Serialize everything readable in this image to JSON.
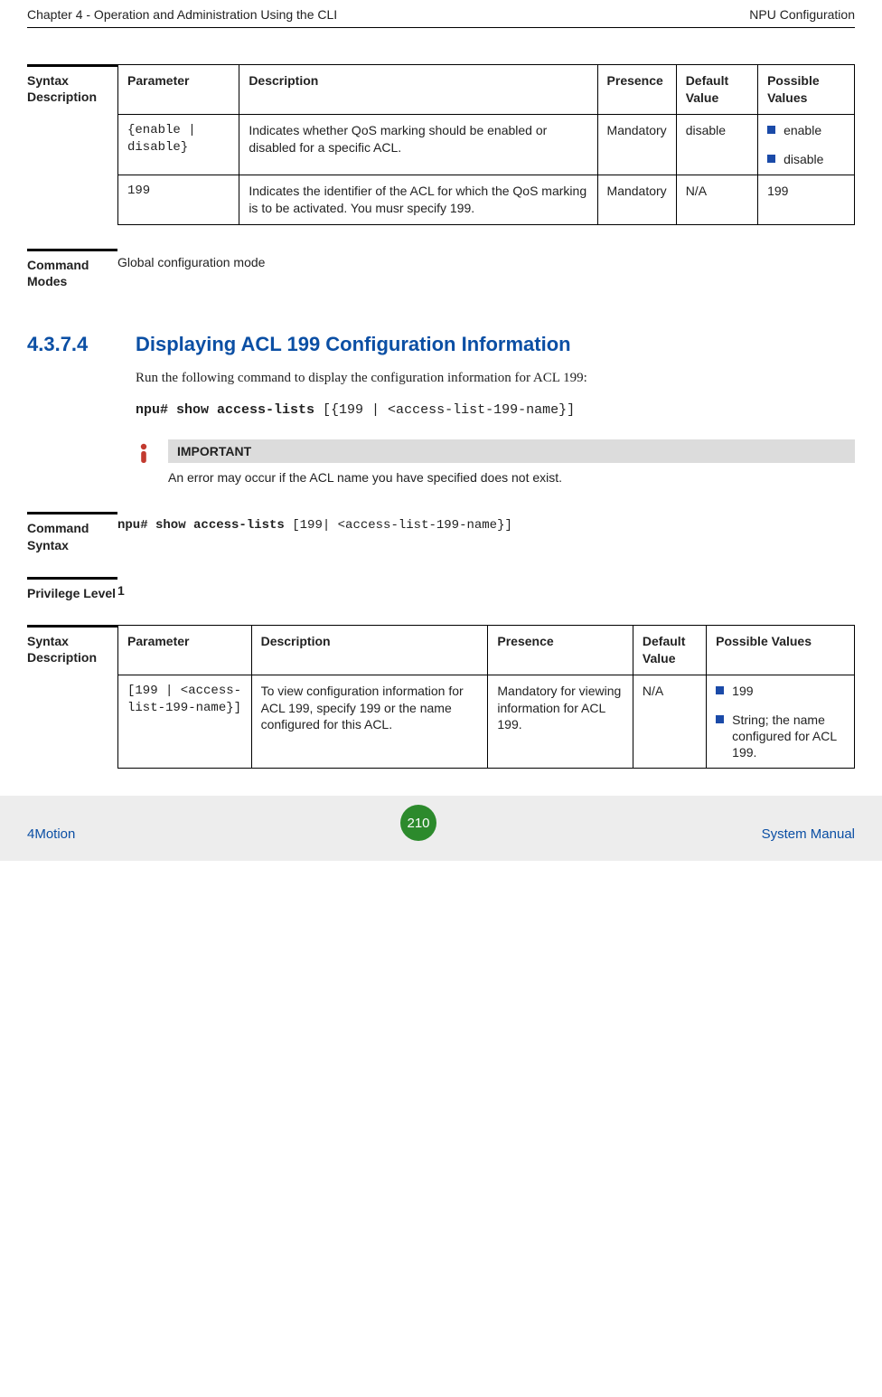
{
  "header": {
    "left": "Chapter 4 - Operation and Administration Using the CLI",
    "right": "NPU Configuration"
  },
  "syntax1": {
    "label": "Syntax Description",
    "columns": [
      "Parameter",
      "Description",
      "Presence",
      "Default Value",
      "Possible Values"
    ],
    "rows": [
      {
        "param": "{enable | disable}",
        "desc": "Indicates whether QoS marking should be enabled or disabled for a specific ACL.",
        "presence": "Mandatory",
        "default": "disable",
        "values": [
          "enable",
          "disable"
        ]
      },
      {
        "param": "199",
        "desc": "Indicates the identifier of the ACL for which the QoS marking is to be activated. You musr specify 199.",
        "presence": "Mandatory",
        "default": "N/A",
        "values_plain": "199"
      }
    ]
  },
  "command_modes": {
    "label": "Command Modes",
    "text": "Global configuration mode"
  },
  "subsection": {
    "number": "4.3.7.4",
    "title": "Displaying ACL 199 Configuration Information",
    "body": "Run the following command to display the configuration information for ACL 199:",
    "cmd_bold": "npu# show access-lists",
    "cmd_rest": " [{199 | <access-list-199-name}]"
  },
  "important": {
    "title": "IMPORTANT",
    "text": "An error may occur if the ACL name you have specified does not exist."
  },
  "command_syntax": {
    "label": "Command Syntax",
    "cmd_bold": "npu# show access-lists",
    "cmd_rest": " [199| <access-list-199-name}]"
  },
  "privilege": {
    "label": "Privilege Level",
    "value": "1"
  },
  "syntax2": {
    "label": "Syntax Description",
    "columns": [
      "Parameter",
      "Description",
      "Presence",
      "Default Value",
      "Possible Values"
    ],
    "rows": [
      {
        "param": "[199 | <access-list-199-name}]",
        "desc": "To view configuration information for ACL 199, specify 199 or the name configured for this ACL.",
        "presence": "Mandatory for viewing information for ACL 199.",
        "default": "N/A",
        "values": [
          "199",
          "String; the name configured for ACL 199."
        ]
      }
    ]
  },
  "footer": {
    "left": "4Motion",
    "page": "210",
    "right": "System Manual"
  },
  "chart_data": null
}
